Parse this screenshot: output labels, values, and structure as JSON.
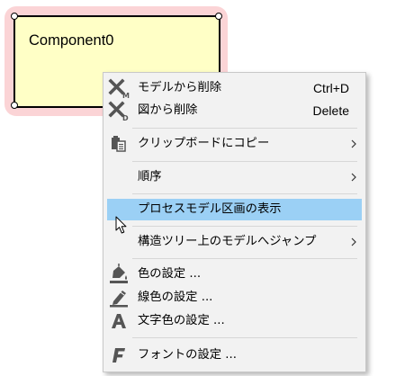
{
  "diagram": {
    "component": {
      "name": "Component0",
      "fill_color": "#ffffc6",
      "selection_color": "#fbd4d6"
    }
  },
  "context_menu": {
    "highlight_color": "#9bd0f5",
    "items": [
      {
        "label": "モデルから削除",
        "shortcut": "Ctrl+D",
        "icon": "delete-model-icon"
      },
      {
        "label": "図から削除",
        "shortcut": "Delete",
        "icon": "delete-diagram-icon"
      },
      {
        "label": "クリップボードにコピー",
        "icon": "clipboard-icon",
        "submenu": true
      },
      {
        "label": "順序",
        "submenu": true
      },
      {
        "label": "プロセスモデル区画の表示",
        "highlighted": true
      },
      {
        "label": "構造ツリー上のモデルへジャンプ",
        "submenu": true
      },
      {
        "label": "色の設定 ...",
        "icon": "paint-bucket-icon"
      },
      {
        "label": "線色の設定 ...",
        "icon": "pen-icon"
      },
      {
        "label": "文字色の設定 ...",
        "icon": "text-color-icon"
      },
      {
        "label": "フォントの設定 ...",
        "icon": "font-icon"
      }
    ]
  }
}
